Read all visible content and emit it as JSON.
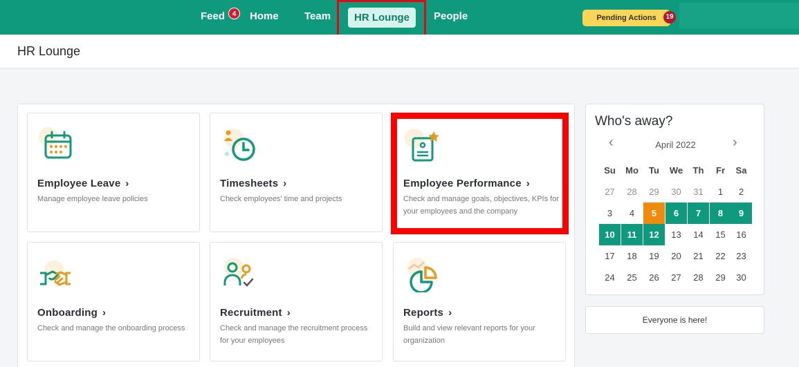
{
  "nav": {
    "items": [
      {
        "label": "Feed",
        "badge": "4"
      },
      {
        "label": "Home"
      },
      {
        "label": "Team"
      },
      {
        "label": "HR Lounge",
        "active": true
      },
      {
        "label": "People"
      }
    ],
    "pending_label": "Pending Actions",
    "pending_count": "19",
    "accent_color": "#0f9a7e"
  },
  "page": {
    "title": "HR Lounge"
  },
  "cards": [
    {
      "title": "Employee Leave",
      "desc": "Manage employee leave policies",
      "icon": "calendar-icon"
    },
    {
      "title": "Timesheets",
      "desc": "Check employees' time and projects",
      "icon": "clock-icon"
    },
    {
      "title": "Employee Performance",
      "desc": "Check and manage goals, objectives, KPIs for your employees and the company",
      "icon": "performance-icon"
    },
    {
      "title": "Onboarding",
      "desc": "Check and manage the onboarding process",
      "icon": "handshake-icon"
    },
    {
      "title": "Recruitment",
      "desc": "Check and manage the recruitment process for your employees",
      "icon": "recruitment-icon"
    },
    {
      "title": "Reports",
      "desc": "Build and view relevant reports for your organization",
      "icon": "pie-chart-icon"
    }
  ],
  "away": {
    "title": "Who's away?",
    "month": "April 2022",
    "weekdays": [
      "Su",
      "Mo",
      "Tu",
      "We",
      "Th",
      "Fr",
      "Sa"
    ],
    "weeks": [
      [
        [
          "27",
          "muted"
        ],
        [
          "28",
          "muted"
        ],
        [
          "29",
          "muted"
        ],
        [
          "30",
          "muted"
        ],
        [
          "31",
          "muted"
        ],
        [
          "1",
          "normal"
        ],
        [
          "2",
          "normal"
        ]
      ],
      [
        [
          "3",
          "normal"
        ],
        [
          "4",
          "normal"
        ],
        [
          "5",
          "today"
        ],
        [
          "6",
          "away"
        ],
        [
          "7",
          "away"
        ],
        [
          "8",
          "away"
        ],
        [
          "9",
          "away"
        ]
      ],
      [
        [
          "10",
          "away"
        ],
        [
          "11",
          "away"
        ],
        [
          "12",
          "away"
        ],
        [
          "13",
          "normal"
        ],
        [
          "14",
          "normal"
        ],
        [
          "15",
          "normal"
        ],
        [
          "16",
          "normal"
        ]
      ],
      [
        [
          "17",
          "normal"
        ],
        [
          "18",
          "normal"
        ],
        [
          "19",
          "normal"
        ],
        [
          "20",
          "normal"
        ],
        [
          "21",
          "normal"
        ],
        [
          "22",
          "normal"
        ],
        [
          "23",
          "normal"
        ]
      ],
      [
        [
          "24",
          "normal"
        ],
        [
          "25",
          "normal"
        ],
        [
          "26",
          "normal"
        ],
        [
          "27",
          "normal"
        ],
        [
          "28",
          "normal"
        ],
        [
          "29",
          "normal"
        ],
        [
          "30",
          "normal"
        ]
      ]
    ],
    "everyone_label": "Everyone is here!"
  }
}
